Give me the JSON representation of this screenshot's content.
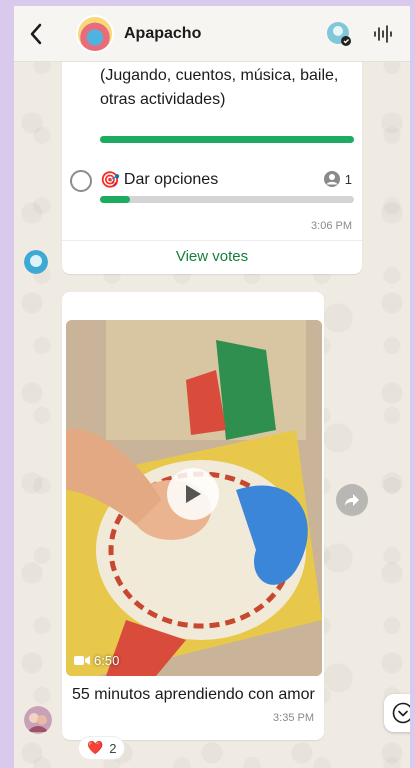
{
  "header": {
    "title": "Apapacho",
    "back_icon": "chevron-left-icon",
    "group_icon": "group-avatar",
    "participant_icon": "sticker-avatar-icon",
    "call_icon": "audio-wave-icon"
  },
  "poll": {
    "option_text_partial": "(Jugando, cuentos, música, baile, otras actividades)",
    "option_partial_progress": 1.0,
    "option2_label": "Dar opciones",
    "option2_emoji": "🎯",
    "option2_votes": "1",
    "option2_progress": 0.12,
    "time": "3:06 PM",
    "view_votes": "View votes"
  },
  "video_message": {
    "duration": "6:50",
    "caption": "55 minutos aprendiendo con amor",
    "time": "3:35 PM",
    "reaction_emoji": "❤️",
    "reaction_count": "2"
  },
  "colors": {
    "accent_green": "#1daa61",
    "chat_background": "#efeae2",
    "frame": "#d9c9ec"
  }
}
